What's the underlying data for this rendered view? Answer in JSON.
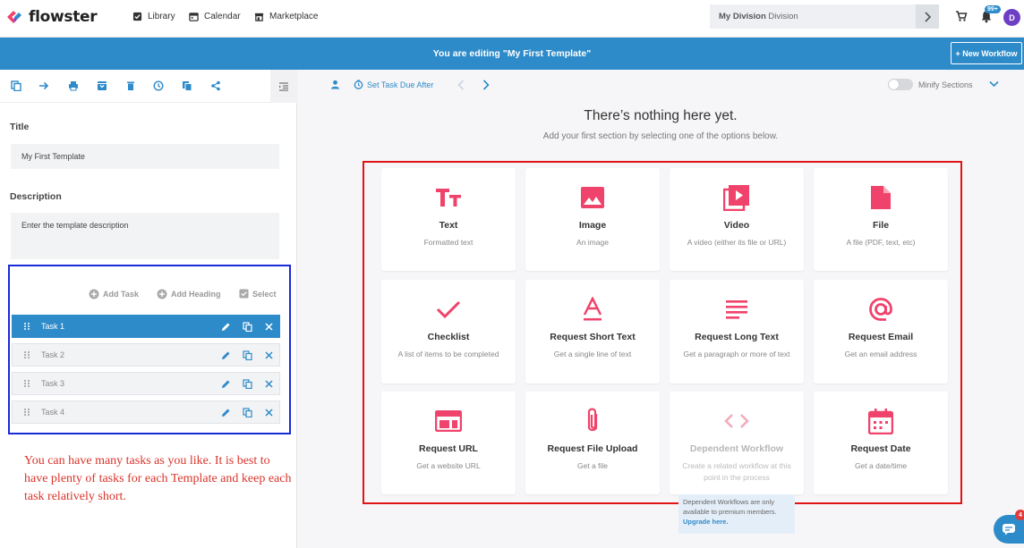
{
  "nav": {
    "logo_text": "flowster",
    "links": [
      "Library",
      "Calendar",
      "Marketplace"
    ],
    "division_bold": "My Division",
    "division_rest": " Division",
    "notification_badge": "99+",
    "avatar_initial": "D"
  },
  "banner": {
    "text": "You are editing \"My First Template\"",
    "new_workflow": "+ New Workflow"
  },
  "left": {
    "title_label": "Title",
    "title_value": "My First Template",
    "description_label": "Description",
    "description_placeholder": "Enter the template description",
    "add_task": "Add Task",
    "add_heading": "Add Heading",
    "select": "Select",
    "tasks": [
      "Task 1",
      "Task 2",
      "Task 3",
      "Task 4"
    ],
    "annotation": "You can have many tasks as you like. It is best to have plenty of tasks for each Template and keep each task relatively short."
  },
  "toolbar": {
    "set_due": "Set Task Due After",
    "minify": "Minify Sections"
  },
  "empty": {
    "title": "There’s nothing here yet.",
    "subtitle": "Add your first section by selecting one of the options below."
  },
  "options": [
    {
      "title": "Text",
      "desc": "Formatted text",
      "icon": "text-icon"
    },
    {
      "title": "Image",
      "desc": "An image",
      "icon": "image-icon"
    },
    {
      "title": "Video",
      "desc": "A video (either its file or URL)",
      "icon": "video-icon"
    },
    {
      "title": "File",
      "desc": "A file (PDF, text, etc)",
      "icon": "file-icon"
    },
    {
      "title": "Checklist",
      "desc": "A list of items to be completed",
      "icon": "checkmark-icon"
    },
    {
      "title": "Request Short Text",
      "desc": "Get a single line of text",
      "icon": "short-text-icon"
    },
    {
      "title": "Request Long Text",
      "desc": "Get a paragraph or more of text",
      "icon": "long-text-icon"
    },
    {
      "title": "Request Email",
      "desc": "Get an email address",
      "icon": "at-icon"
    },
    {
      "title": "Request URL",
      "desc": "Get a website URL",
      "icon": "browser-icon"
    },
    {
      "title": "Request File Upload",
      "desc": "Get a file",
      "icon": "paperclip-icon"
    },
    {
      "title": "Dependent Workflow",
      "desc": "Create a related workflow at this point in the process",
      "icon": "code-icon",
      "disabled": true
    },
    {
      "title": "Request Date",
      "desc": "Get a date/time",
      "icon": "calendar-icon"
    }
  ],
  "premium": {
    "text": "Dependent Workflows are only available to premium members.",
    "link": "Upgrade here."
  },
  "chat_badge": "4",
  "colors": {
    "brand_blue": "#2e8bc9",
    "accent_pink": "#f0436b"
  }
}
